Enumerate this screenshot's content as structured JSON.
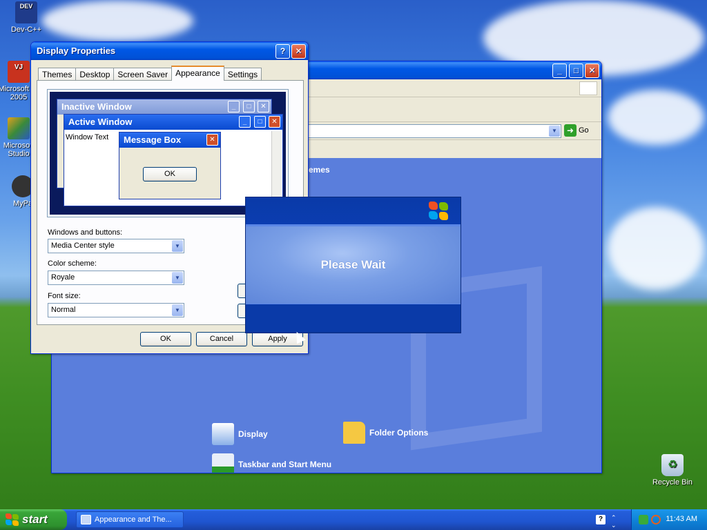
{
  "desktop": {
    "icons": [
      {
        "label": "Dev-C++"
      },
      {
        "label": "Microsoft J# 2005"
      },
      {
        "label": "Microsoft Studio"
      },
      {
        "label": "MyPa"
      },
      {
        "label": "Recycle Bin"
      }
    ]
  },
  "control_panel": {
    "go_label": "Go",
    "heading": "emes",
    "tasks": [
      {
        "label": "Display"
      },
      {
        "label": "Folder Options"
      },
      {
        "label": "Taskbar and Start Menu"
      }
    ]
  },
  "display_properties": {
    "title": "Display Properties",
    "tabs": [
      {
        "label": "Themes"
      },
      {
        "label": "Desktop"
      },
      {
        "label": "Screen Saver"
      },
      {
        "label": "Appearance"
      },
      {
        "label": "Settings"
      }
    ],
    "active_tab": "Appearance",
    "preview": {
      "inactive_title": "Inactive Window",
      "active_title": "Active Window",
      "window_text": "Window Text",
      "message_box_title": "Message Box",
      "ok_label": "OK"
    },
    "windows_buttons_label": "Windows and buttons:",
    "windows_buttons_value": "Media Center style",
    "color_scheme_label": "Color scheme:",
    "color_scheme_value": "Royale",
    "font_size_label": "Font size:",
    "font_size_value": "Normal",
    "ok_label": "OK",
    "cancel_label": "Cancel",
    "apply_label": "Apply"
  },
  "please_wait": {
    "text": "Please Wait"
  },
  "taskbar": {
    "start_label": "start",
    "task_button_label": "Appearance and The...",
    "clock": "11:43 AM"
  },
  "colors": {
    "xp_title_blue": "#0058e6",
    "start_green": "#39a539",
    "tray_blue": "#0f84d9",
    "cp_content_blue": "#5a7edc",
    "please_wait_dark": "#0a3aa8"
  }
}
